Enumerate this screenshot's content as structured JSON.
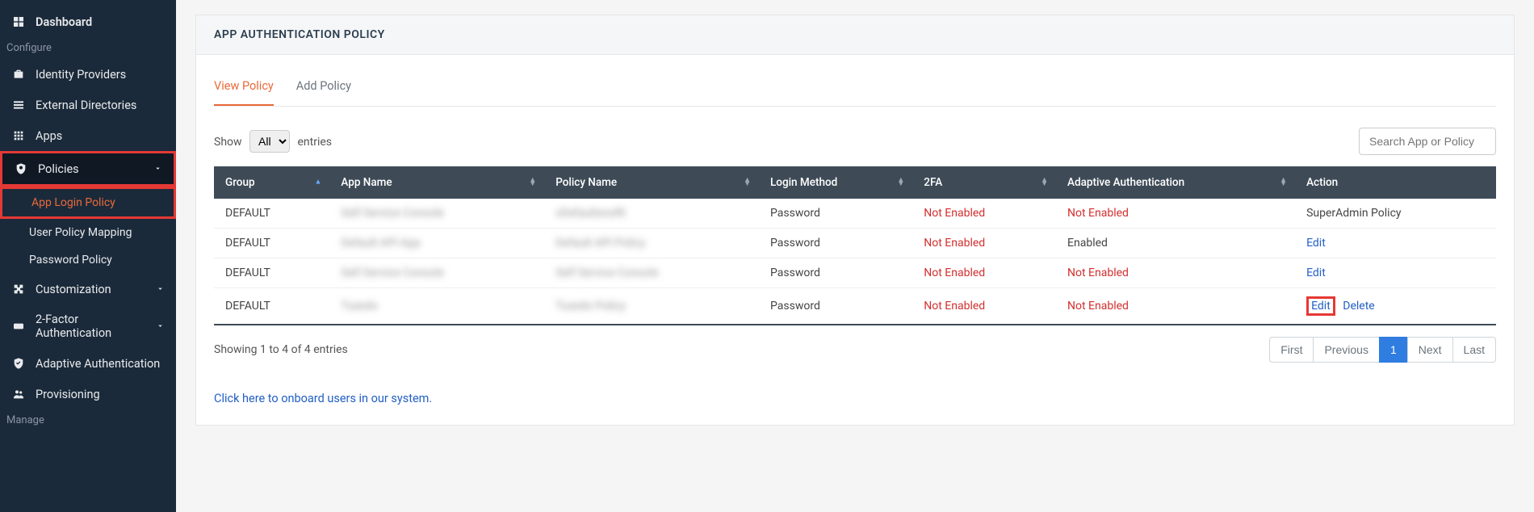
{
  "sidebar": {
    "dashboard": "Dashboard",
    "section_configure": "Configure",
    "identity_providers": "Identity Providers",
    "external_directories": "External Directories",
    "apps": "Apps",
    "policies": "Policies",
    "policies_sub": {
      "app_login_policy": "App Login Policy",
      "user_policy_mapping": "User Policy Mapping",
      "password_policy": "Password Policy"
    },
    "customization": "Customization",
    "two_factor_auth": "2-Factor Authentication",
    "adaptive_auth": "Adaptive Authentication",
    "provisioning": "Provisioning",
    "section_manage": "Manage"
  },
  "page": {
    "header": "APP AUTHENTICATION POLICY",
    "tabs": {
      "view": "View Policy",
      "add": "Add Policy"
    },
    "show_label": "Show",
    "entries_label": "entries",
    "entries_select": "All",
    "search_placeholder": "Search App or Policy",
    "columns": {
      "group": "Group",
      "app_name": "App Name",
      "policy_name": "Policy Name",
      "login_method": "Login Method",
      "two_fa": "2FA",
      "adaptive_auth": "Adaptive Authentication",
      "action": "Action"
    },
    "rows": [
      {
        "group": "DEFAULT",
        "app_name": "Self Service Console",
        "policy_name": "xDefaultxnxRt",
        "login_method": "Password",
        "two_fa": "Not Enabled",
        "adaptive": "Not Enabled",
        "action_text": "SuperAdmin Policy",
        "action_type": "text"
      },
      {
        "group": "DEFAULT",
        "app_name": "Default API App",
        "policy_name": "Default API Policy",
        "login_method": "Password",
        "two_fa": "Not Enabled",
        "adaptive": "Enabled",
        "action_text": "Edit",
        "action_type": "edit"
      },
      {
        "group": "DEFAULT",
        "app_name": "Self Service Console",
        "policy_name": "Self Service Console",
        "login_method": "Password",
        "two_fa": "Not Enabled",
        "adaptive": "Not Enabled",
        "action_text": "Edit",
        "action_type": "edit"
      },
      {
        "group": "DEFAULT",
        "app_name": "Tuxedo",
        "policy_name": "Tuxedo Policy",
        "login_method": "Password",
        "two_fa": "Not Enabled",
        "adaptive": "Not Enabled",
        "action_text": "Edit",
        "action_type": "edit_delete",
        "delete_text": "Delete"
      }
    ],
    "footer_info": "Showing 1 to 4 of 4 entries",
    "pagination": {
      "first": "First",
      "previous": "Previous",
      "page1": "1",
      "next": "Next",
      "last": "Last"
    },
    "onboard_link": "Click here to onboard users in our system."
  }
}
